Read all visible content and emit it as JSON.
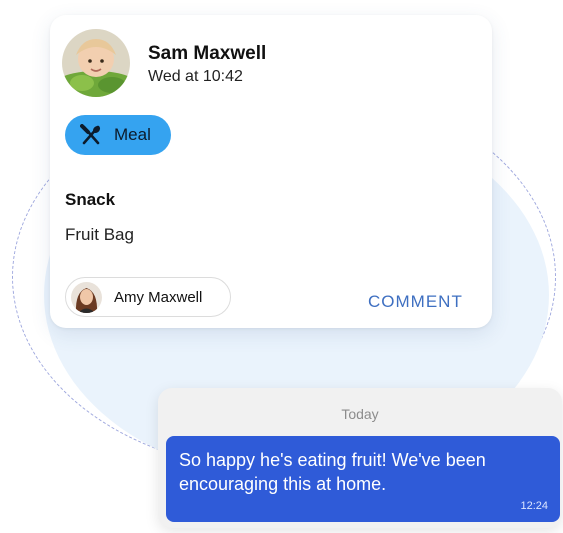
{
  "post": {
    "author_name": "Sam Maxwell",
    "timestamp": "Wed at 10:42",
    "activity": {
      "label": "Meal",
      "icon": "fork-knife-icon",
      "color": "#35a3f0"
    },
    "section_heading": "Snack",
    "section_body": "Fruit Bag",
    "commenter": {
      "name": "Amy Maxwell"
    },
    "comment_label": "COMMENT"
  },
  "chat": {
    "date_separator": "Today",
    "message": {
      "text": "So happy he's eating fruit! We've been encouraging this at home.",
      "time": "12:24",
      "bubble_color": "#2f5bd8"
    }
  },
  "colors": {
    "accent_blue": "#35a3f0",
    "link_blue": "#3e6fc1",
    "background_blob": "#eaf3fc"
  }
}
